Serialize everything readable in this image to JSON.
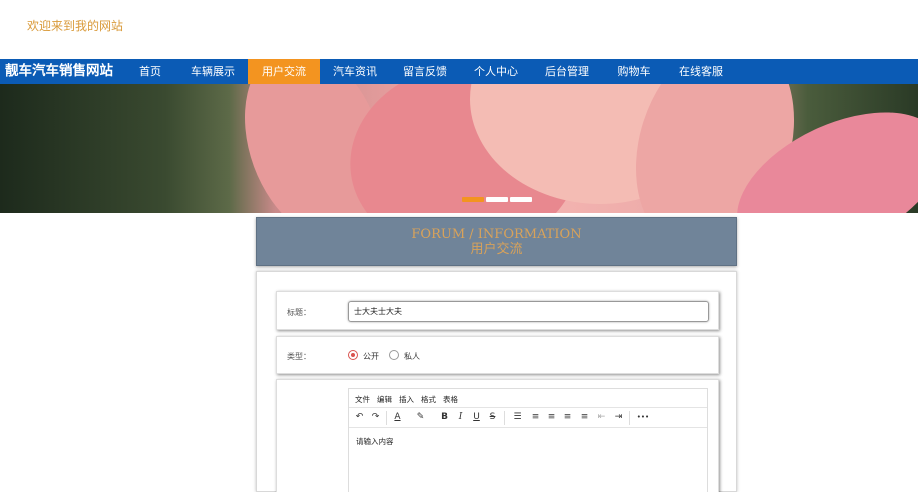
{
  "header": {
    "welcome": "欢迎来到我的网站"
  },
  "nav": {
    "brand": "靓车汽车销售网站",
    "items": [
      {
        "label": "首页"
      },
      {
        "label": "车辆展示"
      },
      {
        "label": "用户交流",
        "active": true
      },
      {
        "label": "汽车资讯"
      },
      {
        "label": "留言反馈"
      },
      {
        "label": "个人中心"
      },
      {
        "label": "后台管理"
      },
      {
        "label": "购物车"
      },
      {
        "label": "在线客服"
      }
    ]
  },
  "banner": {
    "slides": 3,
    "active_slide": 1
  },
  "forum": {
    "title_en": "FORUM / INFORMATION",
    "title_cn": "用户交流"
  },
  "form": {
    "title_label": "标题：",
    "title_value": "士大夫士大夫",
    "type_label": "类型：",
    "type_options": [
      "公开",
      "私人"
    ],
    "type_selected": "公开",
    "editor": {
      "menu": [
        "文件",
        "编辑",
        "插入",
        "格式",
        "表格"
      ],
      "toolbar": [
        {
          "icon": "undo-icon",
          "glyph": "↶"
        },
        {
          "icon": "redo-icon",
          "glyph": "↷"
        },
        {
          "icon": "text-color-icon",
          "glyph": "A"
        },
        {
          "icon": "highlight-color-icon",
          "glyph": "✎"
        },
        {
          "icon": "bold-icon",
          "glyph": "B"
        },
        {
          "icon": "italic-icon",
          "glyph": "I"
        },
        {
          "icon": "underline-icon",
          "glyph": "U"
        },
        {
          "icon": "strikethrough-icon",
          "glyph": "S"
        },
        {
          "icon": "bullet-list-icon",
          "glyph": "☰"
        },
        {
          "icon": "align-left-icon",
          "glyph": "≡"
        },
        {
          "icon": "align-center-icon",
          "glyph": "≡"
        },
        {
          "icon": "align-right-icon",
          "glyph": "≡"
        },
        {
          "icon": "align-justify-icon",
          "glyph": "≡"
        },
        {
          "icon": "outdent-icon",
          "glyph": "⇤"
        },
        {
          "icon": "indent-icon",
          "glyph": "⇥"
        },
        {
          "icon": "more-icon",
          "glyph": "•••"
        }
      ],
      "placeholder": "请输入内容"
    }
  },
  "colors": {
    "nav_bg": "#0b5bb5",
    "accent": "#f39420",
    "forum_head_bg": "#708499",
    "welcome_text": "#d99a3a"
  }
}
